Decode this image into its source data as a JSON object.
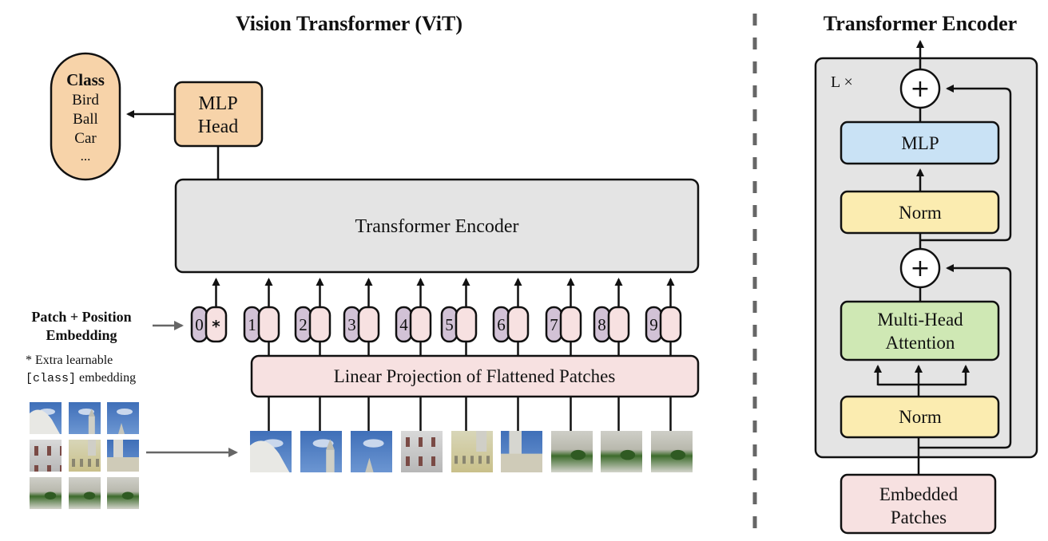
{
  "left_panel": {
    "title": "Vision Transformer (ViT)",
    "class_box": {
      "heading": "Class",
      "items": [
        "Bird",
        "Ball",
        "Car",
        "..."
      ]
    },
    "mlp_head": {
      "line1": "MLP",
      "line2": "Head"
    },
    "transformer_encoder": {
      "label": "Transformer Encoder"
    },
    "embedding_label": {
      "line1": "Patch + Position",
      "line2": "Embedding"
    },
    "footnote": {
      "line1": "* Extra learnable",
      "code": "[class]",
      "line2_rest": " embedding"
    },
    "tokens": [
      {
        "position": "0",
        "content": "*"
      },
      {
        "position": "1",
        "content": ""
      },
      {
        "position": "2",
        "content": ""
      },
      {
        "position": "3",
        "content": ""
      },
      {
        "position": "4",
        "content": ""
      },
      {
        "position": "5",
        "content": ""
      },
      {
        "position": "6",
        "content": ""
      },
      {
        "position": "7",
        "content": ""
      },
      {
        "position": "8",
        "content": ""
      },
      {
        "position": "9",
        "content": ""
      }
    ],
    "linear_projection": {
      "label": "Linear Projection of Flattened Patches"
    },
    "patches": [
      {
        "id": 1,
        "scene": "dome-sky"
      },
      {
        "id": 2,
        "scene": "sky-tower"
      },
      {
        "id": 3,
        "scene": "sky-spire"
      },
      {
        "id": 4,
        "scene": "white-facade"
      },
      {
        "id": 5,
        "scene": "yellow-facade"
      },
      {
        "id": 6,
        "scene": "tower-facade"
      },
      {
        "id": 7,
        "scene": "garden-left"
      },
      {
        "id": 8,
        "scene": "garden-mid"
      },
      {
        "id": 9,
        "scene": "garden-right"
      }
    ],
    "image_grid": {
      "rows": 3,
      "cols": 3
    }
  },
  "right_panel": {
    "title": "Transformer Encoder",
    "repeat_label": "L ×",
    "add_symbol": "+",
    "blocks": {
      "mlp": "MLP",
      "norm_top": "Norm",
      "attention_line1": "Multi-Head",
      "attention_line2": "Attention",
      "norm_bottom": "Norm",
      "embedded_line1": "Embedded",
      "embedded_line2": "Patches"
    }
  },
  "colors": {
    "class_fill": "#f7d3a9",
    "mlp_head_fill": "#f7d3a9",
    "encoder_fill": "#e4e4e4",
    "position_fill": "#d2c2d6",
    "patch_embed_fill": "#f7e1e1",
    "projection_fill": "#f7e1e1",
    "mlp_fill": "#c9e2f5",
    "norm_fill": "#fbecb0",
    "attention_fill": "#cfe8b4",
    "embedded_fill": "#f7e1e1",
    "separator": "#666666",
    "arrow_gray": "#666666",
    "stroke": "#111111"
  }
}
